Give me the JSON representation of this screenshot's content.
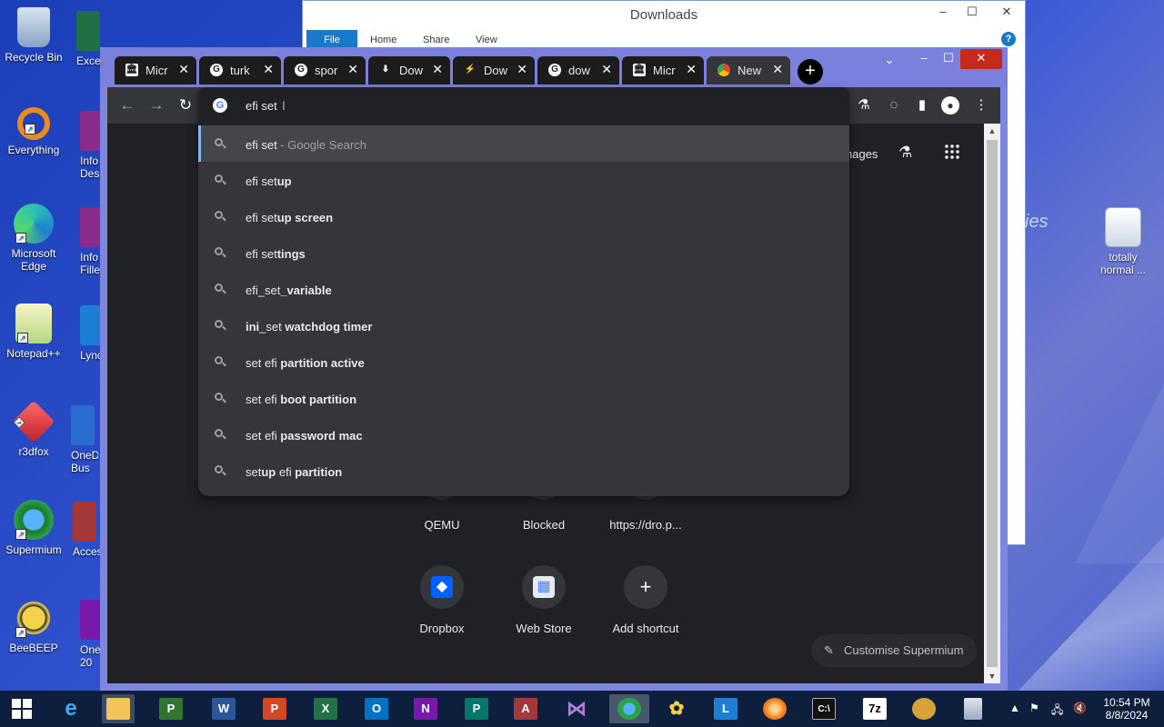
{
  "desktop": {
    "icons": [
      {
        "label": "Recycle Bin"
      },
      {
        "label": "Everything"
      },
      {
        "label": "Microsoft Edge"
      },
      {
        "label": "Notepad++"
      },
      {
        "label": "r3dfox"
      },
      {
        "label": "Supermium"
      },
      {
        "label": "BeeBEEP"
      },
      {
        "label": "totally normal ..."
      }
    ],
    "partial_icons": [
      {
        "label": "Exce"
      },
      {
        "label": "Info Des"
      },
      {
        "label": "Info Filler"
      },
      {
        "label": "Lync"
      },
      {
        "label": "OneD Bus"
      },
      {
        "label": "Acces"
      },
      {
        "label": "One 20"
      }
    ]
  },
  "explorer": {
    "title": "Downloads",
    "ribbon": {
      "file": "File",
      "home": "Home",
      "share": "Share",
      "view": "View"
    },
    "side_text": "ies"
  },
  "browser": {
    "tabs": [
      {
        "label": "Micr",
        "icon": "bank-icon"
      },
      {
        "label": "turk",
        "icon": "google-icon"
      },
      {
        "label": "spor",
        "icon": "google-icon"
      },
      {
        "label": "Dow",
        "icon": "download-icon"
      },
      {
        "label": "Dow",
        "icon": "bolt-icon"
      },
      {
        "label": "dow",
        "icon": "google-icon"
      },
      {
        "label": "Micr",
        "icon": "bank-icon"
      },
      {
        "label": "New",
        "icon": "chrome-icon"
      }
    ],
    "omnibox": {
      "value": "efi set",
      "suggestions": [
        {
          "prefix": "efi set",
          "bold": "",
          "suffix": " - Google Search"
        },
        {
          "prefix": "efi set",
          "bold": "up",
          "suffix": ""
        },
        {
          "prefix": "efi set",
          "bold": "up screen",
          "suffix": ""
        },
        {
          "prefix": "efi set",
          "bold": "tings",
          "suffix": ""
        },
        {
          "prefix": "efi_set",
          "bold": "_variable",
          "suffix": ""
        },
        {
          "prefix": "",
          "bold": "ini",
          "mid": "_set",
          "bold2": " watchdog timer"
        },
        {
          "prefix": "set efi ",
          "bold": "partition active",
          "suffix": ""
        },
        {
          "prefix": "set efi ",
          "bold": "boot partition",
          "suffix": ""
        },
        {
          "prefix": "set efi ",
          "bold": "password mac",
          "suffix": ""
        },
        {
          "prefix": "set",
          "bold": "up",
          "mid": " efi ",
          "bold2": "partition"
        }
      ]
    },
    "ntp": {
      "images_link": "Images",
      "images_visible": "nages",
      "shortcuts_row1": [
        "QEMU",
        "Blocked",
        "https://dro.p..."
      ],
      "shortcuts_row2": [
        "Dropbox",
        "Web Store",
        "Add shortcut"
      ],
      "customise": "Customise Supermium"
    }
  },
  "taskbar": {
    "clock_time": "10:54 PM",
    "clock_date": "8/8/2024"
  }
}
